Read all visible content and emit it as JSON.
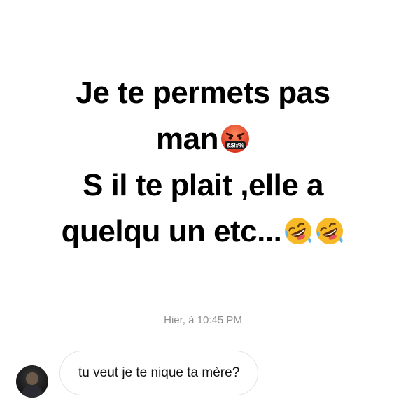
{
  "story": {
    "line1": "Je te permets pas",
    "line2": "man",
    "line3": "S il te plait ,elle a",
    "line4": "quelqu un etc..."
  },
  "emojis": {
    "angry": {
      "icon": "cursing-face-icon",
      "symbols": "&$!#%"
    },
    "laughing": {
      "icon": "rolling-on-floor-laughing-icon"
    }
  },
  "timestamp": "Hier, à 10:45 PM",
  "message": {
    "text": "tu veut je te nique ta mère?"
  },
  "colors": {
    "timestamp": "#8e8e8e",
    "bubble_border": "#e3e3e3",
    "emoji_angry": "#e8452c",
    "emoji_laugh": "#f7b928"
  }
}
